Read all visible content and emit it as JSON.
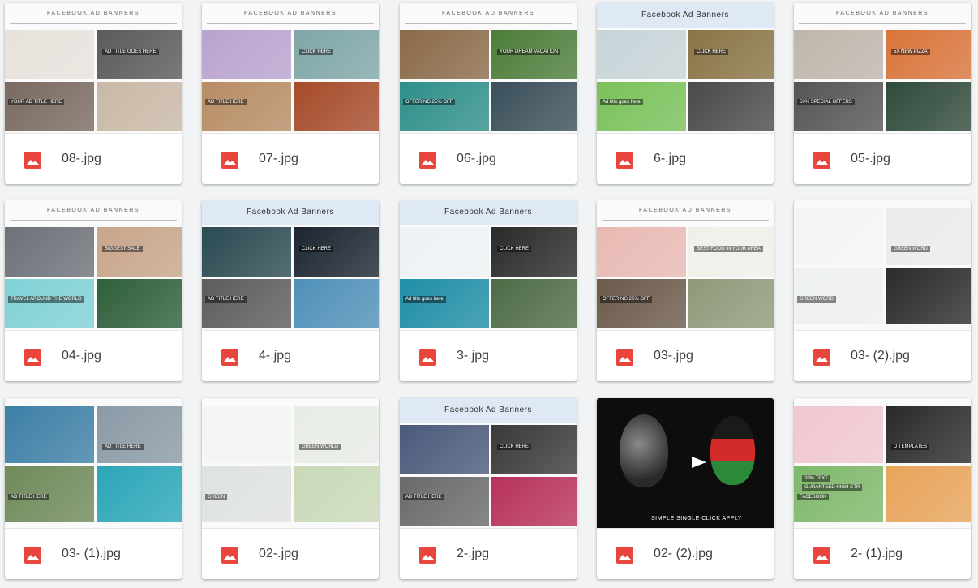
{
  "files": [
    {
      "name": "08-.jpg",
      "thumb": {
        "header": "FACEBOOK AD BANNERS",
        "header_style": "plain",
        "tiles": [
          "#e8e2dc",
          "#5a5a5a",
          "#7a6a60",
          "#c9b8a6"
        ],
        "tags": [
          "YOUR AD TITLE HERE",
          "AD TITLE GOES HERE"
        ]
      }
    },
    {
      "name": "07-.jpg",
      "thumb": {
        "header": "FACEBOOK AD BANNERS",
        "header_style": "plain",
        "tiles": [
          "#b9a3cf",
          "#7fa6a8",
          "#b78c64",
          "#a64b2a"
        ],
        "tags": [
          "AD TITLE HERE",
          "CLICK HERE"
        ]
      }
    },
    {
      "name": "06-.jpg",
      "thumb": {
        "header": "FACEBOOK AD BANNERS",
        "header_style": "plain",
        "tiles": [
          "#8a6a48",
          "#4d7d3a",
          "#2e8f8a",
          "#3a4f5a"
        ],
        "tags": [
          "OFFERING 25% OFF",
          "YOUR DREAM VACATION"
        ]
      }
    },
    {
      "name": "6-.jpg",
      "thumb": {
        "header": "Facebook Ad Banners",
        "header_style": "blue",
        "tiles": [
          "#c8d4d8",
          "#8a7446",
          "#7ac15a",
          "#4a4a4a"
        ],
        "tags": [
          "Ad title goes here",
          "CLICK HERE"
        ]
      }
    },
    {
      "name": "05-.jpg",
      "thumb": {
        "header": "FACEBOOK AD BANNERS",
        "header_style": "plain",
        "tiles": [
          "#bfb6ac",
          "#d9743a",
          "#555555",
          "#2f4a3a"
        ],
        "tags": [
          "50% SPECIAL OFFERS",
          "5X NEW PIZZA"
        ]
      }
    },
    {
      "name": "04-.jpg",
      "thumb": {
        "header": "FACEBOOK AD BANNERS",
        "header_style": "plain",
        "tiles": [
          "#6d7178",
          "#c7a58a",
          "#7fd1d6",
          "#2e5f3a"
        ],
        "tags": [
          "TRAVEL AROUND THE WORLD",
          "BIGGEST SALE"
        ]
      }
    },
    {
      "name": "4-.jpg",
      "thumb": {
        "header": "Facebook Ad Banners",
        "header_style": "blue",
        "tiles": [
          "#2b4a52",
          "#1c2530",
          "#5c5c5c",
          "#4f90b8"
        ],
        "tags": [
          "AD TITLE HERE",
          "CLICK HERE"
        ]
      }
    },
    {
      "name": "3-.jpg",
      "thumb": {
        "header": "Facebook Ad Banners",
        "header_style": "blue",
        "tiles": [
          "#eef2f4",
          "#2a2a2a",
          "#1f8ea6",
          "#4e6b46"
        ],
        "tags": [
          "Ad title goes here",
          "CLICK HERE"
        ]
      }
    },
    {
      "name": "03-.jpg",
      "thumb": {
        "header": "FACEBOOK AD BANNERS",
        "header_style": "plain",
        "tiles": [
          "#e9b9b3",
          "#f1efe9",
          "#6b5a4a",
          "#8f9a7a"
        ],
        "tags": [
          "OFFERING 25% OFF",
          "BEST FOOD IN YOUR AREA"
        ]
      }
    },
    {
      "name": "03- (2).jpg",
      "thumb": {
        "header": "",
        "header_style": "none",
        "tiles": [
          "#f4f6f4",
          "#e9ece9",
          "#eef1ee",
          "#2b2b2b"
        ],
        "tags": [
          "GREEN WORD",
          "GREEN WORD"
        ]
      }
    },
    {
      "name": "03- (1).jpg",
      "thumb": {
        "header": "",
        "header_style": "none",
        "tiles": [
          "#3d7fa6",
          "#8a9aa6",
          "#6f8a5a",
          "#2aa6b8"
        ],
        "tags": [
          "AD TITLE HERE",
          "AD TITLE HERE"
        ]
      }
    },
    {
      "name": "02-.jpg",
      "thumb": {
        "header": "",
        "header_style": "none",
        "tiles": [
          "#f3f5f3",
          "#e8ece6",
          "#dfe3df",
          "#c9d9b8"
        ],
        "tags": [
          "GREEN",
          "GREEN WORLD"
        ]
      }
    },
    {
      "name": "2-.jpg",
      "thumb": {
        "header": "Facebook Ad Banners",
        "header_style": "blue",
        "tiles": [
          "#4a5a7a",
          "#3a3a3a",
          "#6a6a6a",
          "#b8325a"
        ],
        "tags": [
          "AD TITLE HERE",
          "CLICK HERE"
        ]
      }
    },
    {
      "name": "02- (2).jpg",
      "thumb": {
        "header": "",
        "header_style": "dark",
        "tiles": [],
        "tags": [
          "SIMPLE SINGLE CLICK APPLY"
        ]
      }
    },
    {
      "name": "2- (1).jpg",
      "thumb": {
        "header": "",
        "header_style": "none",
        "tiles": [
          "#f0c7cf",
          "#2a2a2a",
          "#7fb86a",
          "#e8a45a"
        ],
        "tags": [
          "FACEBOOK",
          "D TEMPLATES",
          "20% TEXT",
          "GURANTEED HIGH CTR"
        ]
      }
    }
  ],
  "colors": {
    "file_icon": "#e8453c",
    "file_name": "#3c4043",
    "page_bg": "#f1f3f4"
  },
  "icon": "image-file-icon"
}
